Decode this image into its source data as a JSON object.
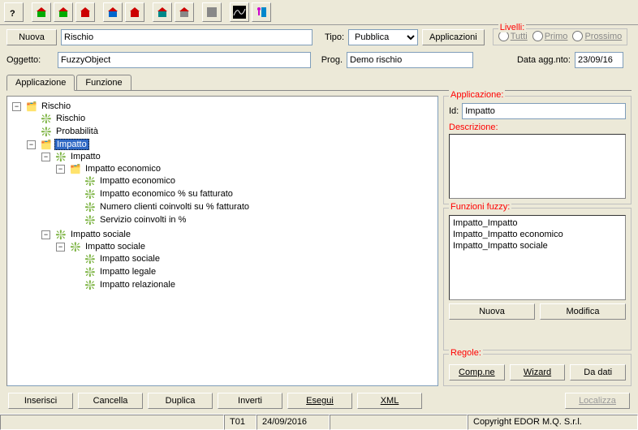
{
  "toolbar": {
    "icons": [
      "help-icon",
      "house-green-icon",
      "house-green2-icon",
      "house-red-icon",
      "house-blue-icon",
      "house-red2-icon",
      "house-teal-icon",
      "house-gray-icon",
      "square-gray-icon",
      "wave-icon",
      "exit-icon"
    ]
  },
  "header": {
    "nuova_btn": "Nuova",
    "rischio_value": "Rischio",
    "tipo_label": "Tipo:",
    "tipo_value": "Pubblica",
    "applicazioni_btn": "Applicazioni",
    "oggetto_label": "Oggetto:",
    "fuzzy_value": "FuzzyObject",
    "prog_label": "Prog.",
    "prog_value": "Demo rischio",
    "data_agg_label": "Data agg.nto:",
    "data_agg_value": "23/09/16",
    "livelli": {
      "legend": "Livelli:",
      "tutti": "Tutti",
      "primo": "Primo",
      "prossimo": "Prossimo"
    }
  },
  "tabs": {
    "applicazione": "Applicazione",
    "funzione": "Funzione"
  },
  "tree": {
    "root": "Rischio",
    "rischio": "Rischio",
    "probabilita": "Probabilità",
    "impatto": "Impatto",
    "impatto2": "Impatto",
    "imp_econ_parent": "Impatto economico",
    "imp_econ": "Impatto economico",
    "imp_econ_pct": "Impatto economico % su fatturato",
    "num_clienti": "Numero clienti coinvolti su % fatturato",
    "servizio": "Servizio coinvolti in %",
    "imp_soc_parent": "Impatto sociale",
    "imp_soc2": "Impatto sociale",
    "imp_soc": "Impatto sociale",
    "imp_legale": "Impatto legale",
    "imp_rel": "Impatto relazionale"
  },
  "right": {
    "applicazione_legend": "Applicazione:",
    "id_label": "Id:",
    "id_value": "Impatto",
    "descrizione_legend": "Descrizione:",
    "funzioni_legend": "Funzioni fuzzy:",
    "funzioni": [
      "Impatto_Impatto",
      "Impatto_Impatto economico",
      "Impatto_Impatto sociale"
    ],
    "nuova_btn": "Nuova",
    "modifica_btn": "Modifica",
    "regole_legend": "Regole:",
    "compne_btn": "Comp.ne",
    "wizard_btn": "Wizard",
    "dadati_btn": "Da dati"
  },
  "bottom": {
    "inserisci": "Inserisci",
    "cancella": "Cancella",
    "duplica": "Duplica",
    "inverti": "Inverti",
    "esegui": "Esegui",
    "xml": "XML",
    "localizza": "Localizza"
  },
  "status": {
    "t01": "T01",
    "date": "24/09/2016",
    "copyright": "Copyright EDOR M.Q. S.r.l."
  }
}
